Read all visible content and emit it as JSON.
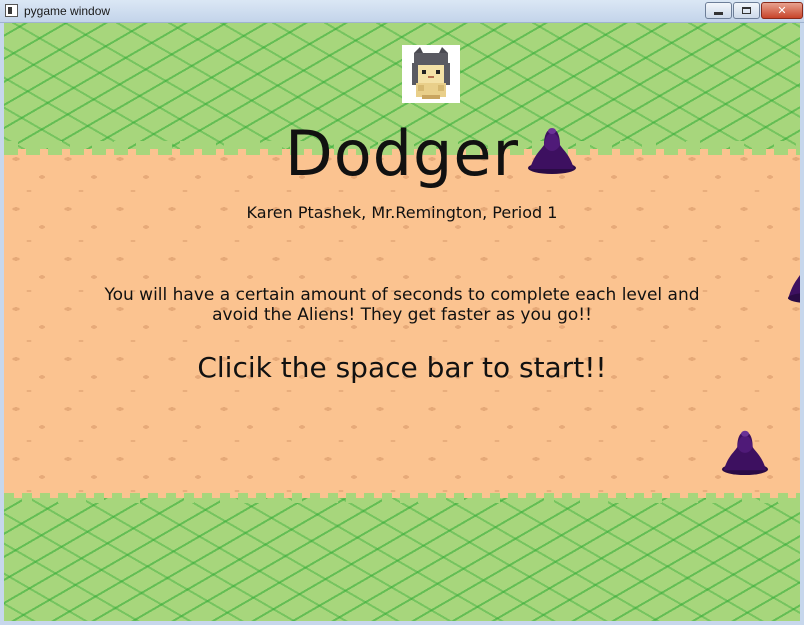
{
  "window": {
    "title": "pygame window",
    "minimize_glyph": "",
    "maximize_glyph": "",
    "close_glyph": "✕"
  },
  "game": {
    "title": "Dodger",
    "credits": "Karen Ptashek, Mr.Remington, Period 1",
    "instructions_line1": "You will have a certain amount of  seconds to complete each level and",
    "instructions_line2": "avoid the Aliens! They get faster as you go!!",
    "start_prompt": "Clicik the space bar to start!!"
  },
  "sprites": {
    "player": "cat-hooded-player-sprite",
    "enemy": "purple-alien-blob"
  },
  "colors": {
    "grass": "#a7d67c",
    "grass_dark": "#2caa34",
    "sand": "#fbc390",
    "alien": "#3d1060"
  }
}
